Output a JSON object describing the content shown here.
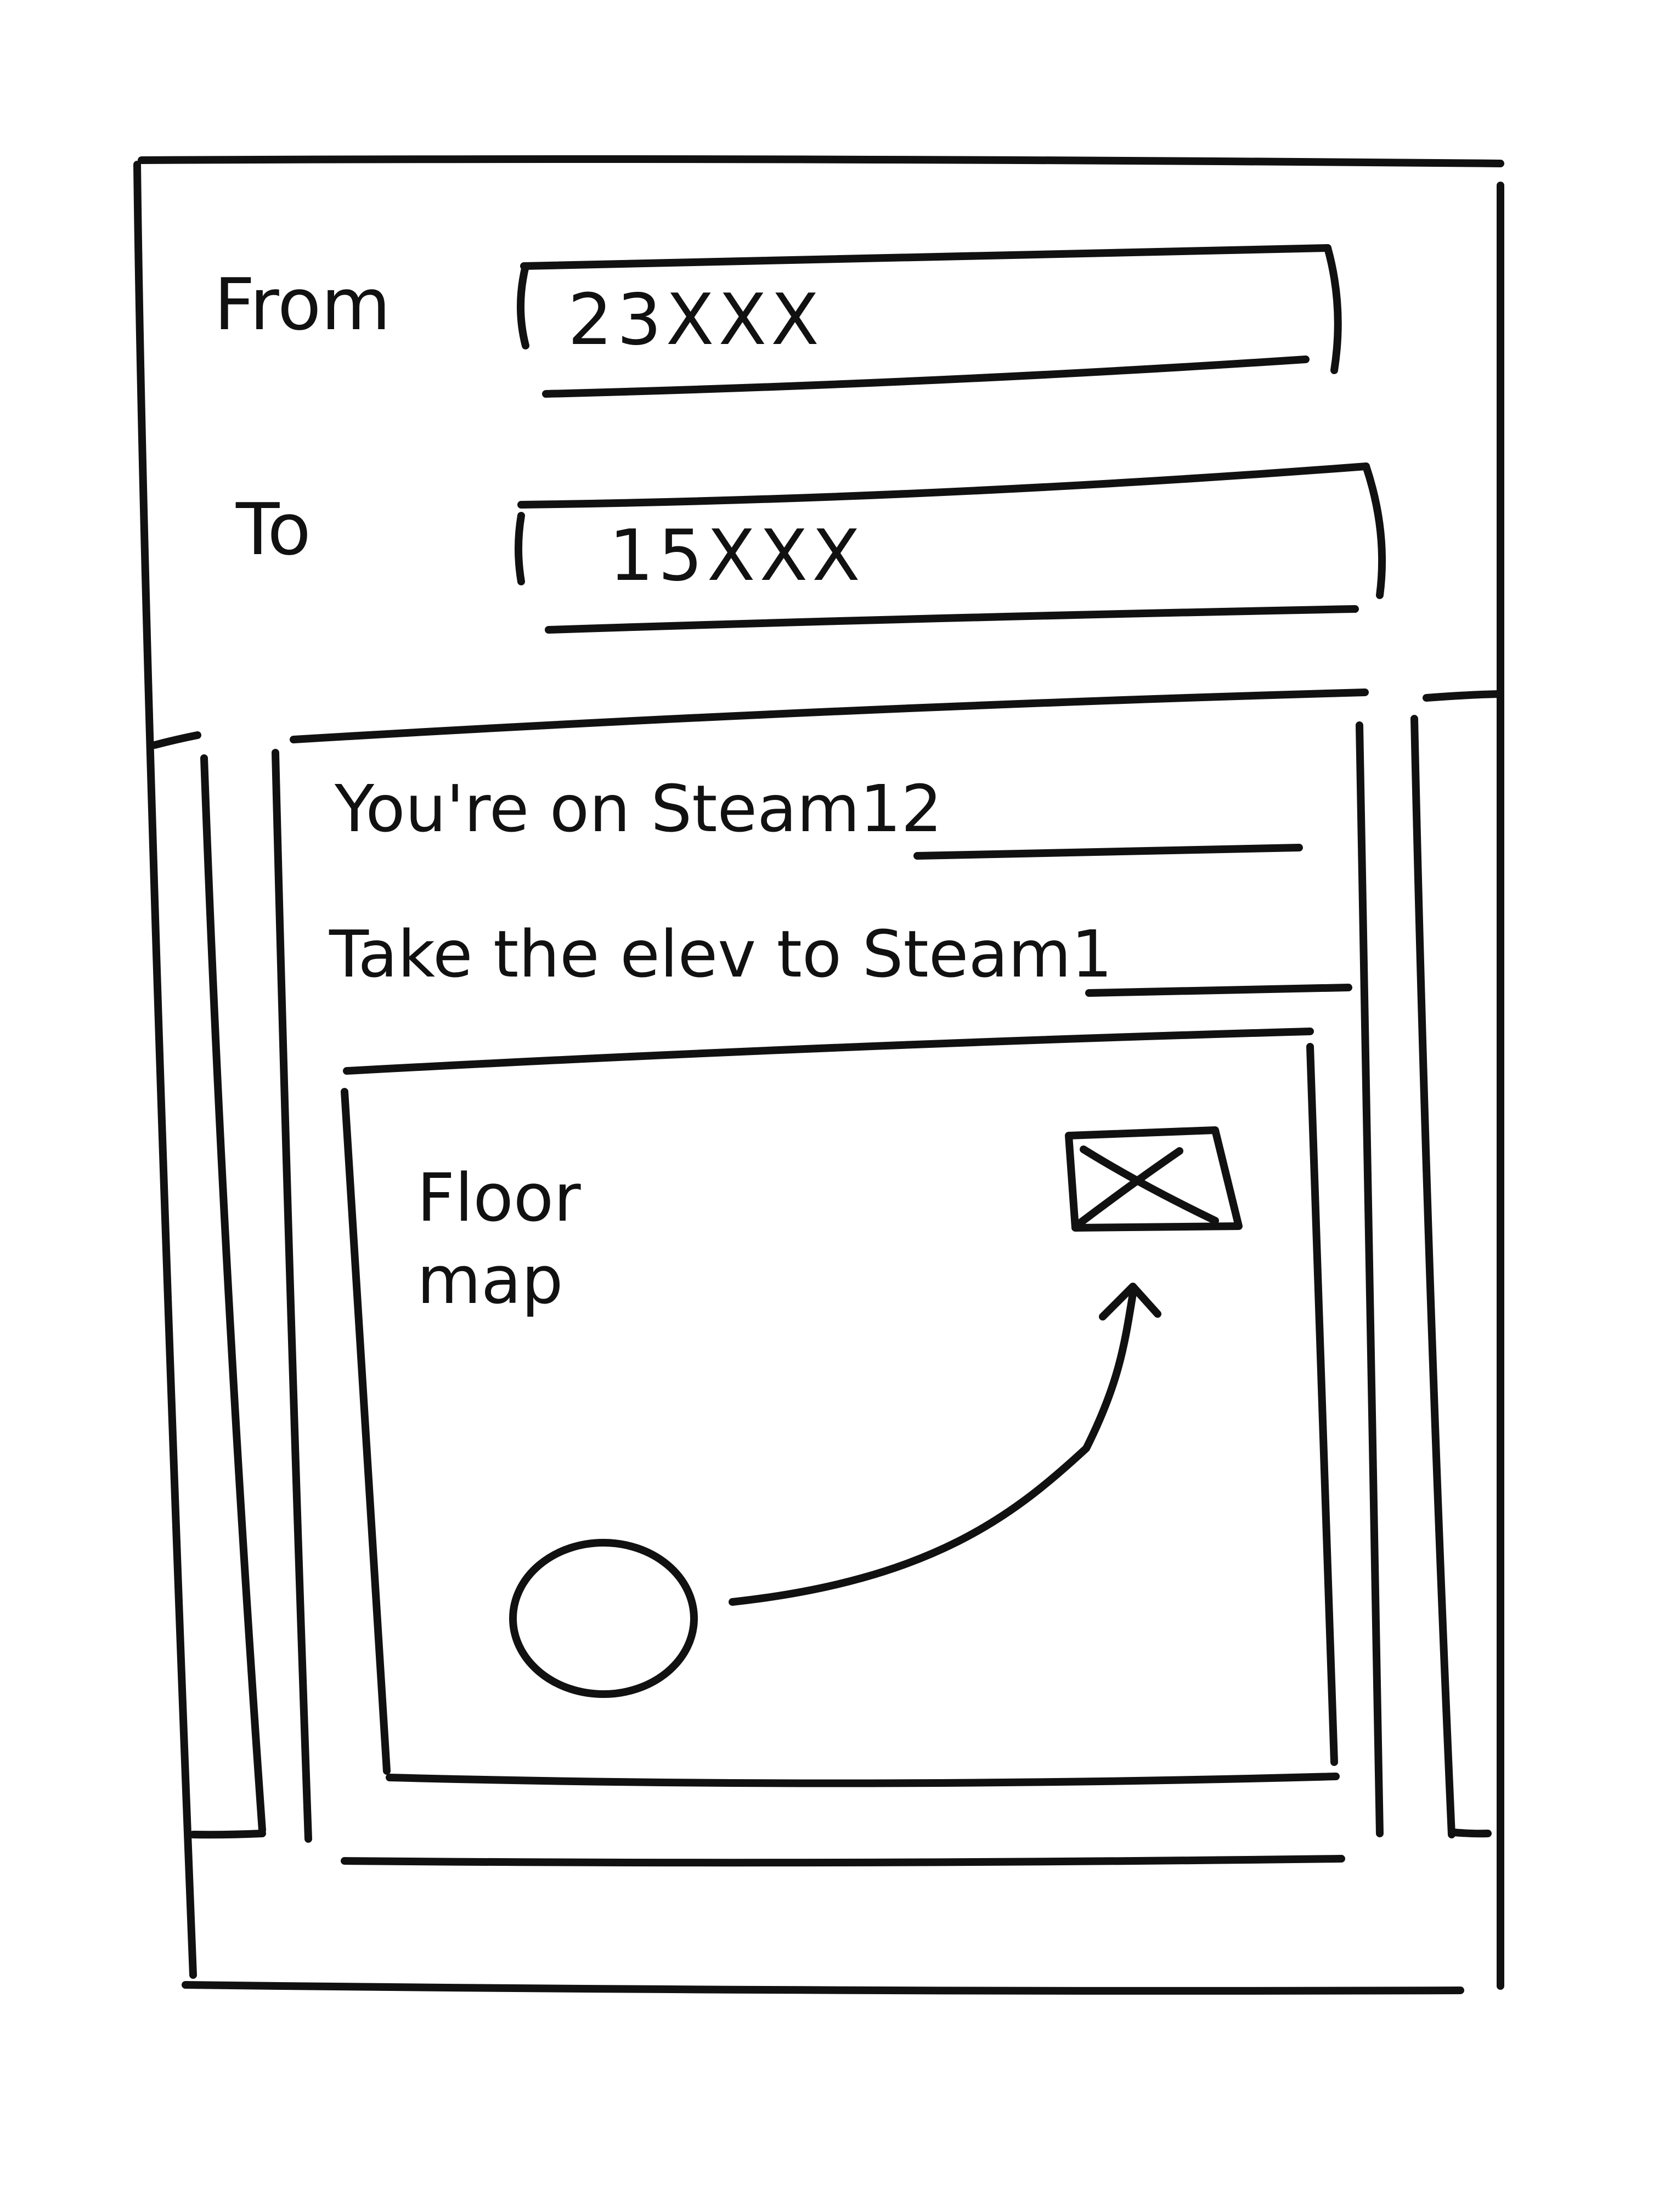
{
  "route_form": {
    "from_label": "From",
    "from_value": "23XXX",
    "to_label": "To",
    "to_value": "15XXX"
  },
  "carousel": {
    "card": {
      "current_prefix": "You're on",
      "current_location": "Steam12",
      "instruction_prefix": "Take the elev to",
      "next_location": "Steam1",
      "map": {
        "title_line1": "Floor",
        "title_line2": "map"
      }
    }
  },
  "icons": {
    "destination": "image-placeholder-icon",
    "start": "start-point-icon",
    "route": "route-arrow-icon"
  }
}
